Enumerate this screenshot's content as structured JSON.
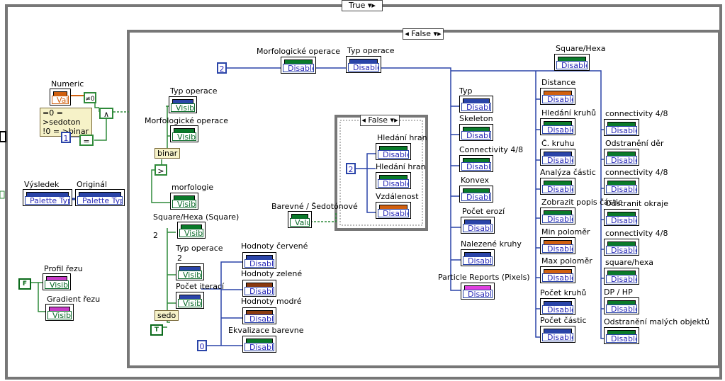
{
  "colors": {
    "wire_blue": "#2a44a8",
    "wire_green": "#2f8a3a",
    "frame_gray": "#777777",
    "bool_green": "#0a7a2a",
    "int_blue": "#2a2ab8",
    "string_pink": "#c63ac6",
    "enum_orange": "#d06010"
  },
  "outer_case": {
    "selector": "True"
  },
  "inner_case": {
    "selector": "False"
  },
  "nested_case": {
    "selector": "False"
  },
  "left": {
    "numeric_label": "Numeric",
    "numeric_value": "Value",
    "not_equal_zero": "≠0",
    "and_symbol": "∧",
    "equal_symbol": "=",
    "mode_text_line1": "=0 = >sedoton",
    "mode_text_line2": "!0 = >binar",
    "const_one": "1",
    "vysledek_label": "Výsledek",
    "vysledek_value": "Palette Type",
    "original_label": "Originál",
    "original_value": "Palette Type",
    "profil_label": "Profil řezu",
    "profil_value": "Visible",
    "gradient_label": "Gradient řezu",
    "gradient_value": "Visible",
    "false_const": "F"
  },
  "middle_left": {
    "typ_operace_label": "Typ operace",
    "typ_operace_value": "Visible",
    "morf_label": "Morfologické operace",
    "morf_value": "Visible",
    "binar_text": "binar",
    "greater_symbol": ">",
    "morfologie_label": "morfologie",
    "morfologie_value": "Visible",
    "square_hexa_label": "Square/Hexa (Square)",
    "square_hexa_num": "2",
    "square_hexa_value": "Visible",
    "typ_operace2_label": "Typ operace",
    "typ_operace2_num": "2",
    "typ_operace2_value": "Visible",
    "pocet_iteraci_label": "Počet iterací",
    "pocet_iteraci_value": "Visible",
    "sedo_text": "sedo",
    "true_const": "T"
  },
  "channels": {
    "cervene_label": "Hodnoty červené",
    "zelene_label": "Hodnoty zelené",
    "modre_label": "Hodnoty modré",
    "ekvalizace_label": "Ekvalizace barevne",
    "disabled": "Disabled",
    "const_zero": "0"
  },
  "top": {
    "const_two": "2",
    "morf_label": "Morfologické operace",
    "morf_value": "Disabled",
    "typ_label": "Typ operace",
    "typ_value": "Disabled",
    "square_label": "Square/Hexa",
    "square_value": "Disabled"
  },
  "nested": {
    "hrana1_label": "Hledání hran",
    "hrana2_label": "Hledání hran",
    "vzdalenost_label": "Vzdálenost",
    "disabled": "Disabled",
    "const_two": "2",
    "barevne_label": "Barevné / Šedotónové",
    "barevne_value": "Value"
  },
  "column_a": {
    "items": [
      {
        "label": "Typ",
        "value": "Disabled"
      },
      {
        "label": "Skeleton",
        "value": "Disabled"
      },
      {
        "label": "Connectivity 4/8",
        "value": "Disabled"
      },
      {
        "label": "Konvex",
        "value": "Disabled"
      },
      {
        "label": "Počet erozí",
        "value": "Disabled"
      },
      {
        "label": "Nalezené kruhy",
        "value": "Disabled"
      },
      {
        "label": "Particle Reports (Pixels)",
        "value": "Disabled"
      }
    ]
  },
  "column_b": {
    "items": [
      {
        "label": "Distance",
        "value": "Disabled"
      },
      {
        "label": "Hledání kruhů",
        "value": "Disabled"
      },
      {
        "label": "Č. kruhu",
        "value": "Disabled"
      },
      {
        "label": "Analýza částic",
        "value": "Disabled"
      },
      {
        "label": "Zobrazit popis částic",
        "value": "Disabled"
      },
      {
        "label": "Min poloměr",
        "value": "Disabled"
      },
      {
        "label": "Max poloměr",
        "value": "Disabled"
      },
      {
        "label": "Počet kruhů",
        "value": "Disabled"
      },
      {
        "label": "Počet částic",
        "value": "Disabled"
      }
    ]
  },
  "column_c": {
    "items": [
      {
        "label": "connectivity 4/8",
        "value": "Disabled"
      },
      {
        "label": "Odstranění děr",
        "value": "Disabled"
      },
      {
        "label": "connectivity 4/8",
        "value": "Disabled"
      },
      {
        "label": "Odstranit okraje",
        "value": "Disabled"
      },
      {
        "label": "connectivity 4/8",
        "value": "Disabled"
      },
      {
        "label": "square/hexa",
        "value": "Disabled"
      },
      {
        "label": "DP / HP",
        "value": "Disabled"
      },
      {
        "label": "Odstranění malých objektů",
        "value": "Disabled"
      }
    ]
  }
}
